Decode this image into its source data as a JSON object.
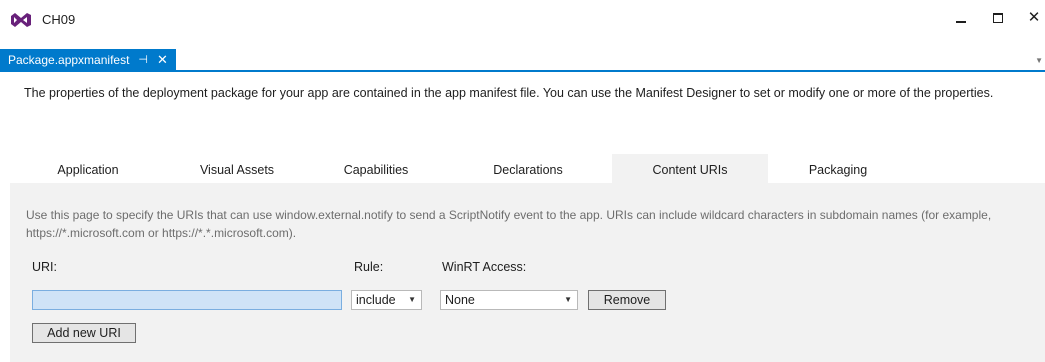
{
  "window": {
    "title": "CH09",
    "accent": "#007acc",
    "logo_color": "#68217a",
    "close_glyph": "✕"
  },
  "doc_tab": {
    "label": "Package.appxmanifest",
    "pin_glyph": "⊣",
    "close_glyph": "✕"
  },
  "designer": {
    "description": "The properties of the deployment package for your app are contained in the app manifest file. You can use the Manifest Designer to set or modify one or more of the properties.",
    "tabs": [
      {
        "label": "Application"
      },
      {
        "label": "Visual Assets"
      },
      {
        "label": "Capabilities"
      },
      {
        "label": "Declarations"
      },
      {
        "label": "Content URIs",
        "selected": true
      },
      {
        "label": "Packaging"
      }
    ],
    "content_uris": {
      "description": "Use this page to specify the URIs that can use window.external.notify to send a ScriptNotify event to the app. URIs can include wildcard characters in subdomain names (for example, https://*.microsoft.com or https://*.*.microsoft.com).",
      "uri_label": "URI:",
      "rule_label": "Rule:",
      "winrt_label": "WinRT Access:",
      "uri_value": "",
      "rule_value": "include",
      "winrt_value": "None",
      "remove_label": "Remove",
      "add_label": "Add new URI"
    }
  }
}
